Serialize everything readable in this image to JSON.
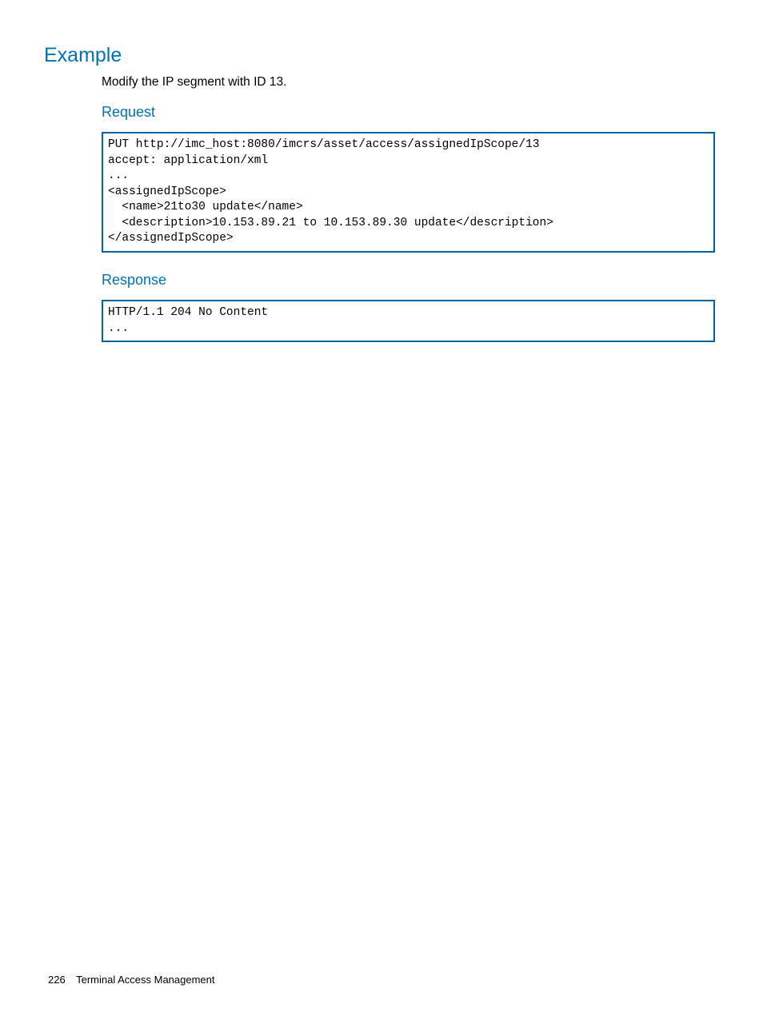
{
  "headings": {
    "example": "Example",
    "request": "Request",
    "response": "Response"
  },
  "body": {
    "intro": "Modify the IP segment with ID 13."
  },
  "code": {
    "request": "PUT http://imc_host:8080/imcrs/asset/access/assignedIpScope/13\naccept: application/xml\n...\n<assignedIpScope>\n  <name>21to30 update</name>\n  <description>10.153.89.21 to 10.153.89.30 update</description>\n</assignedIpScope>",
    "response": "HTTP/1.1 204 No Content\n..."
  },
  "footer": {
    "page_number": "226",
    "chapter": "Terminal Access Management"
  }
}
